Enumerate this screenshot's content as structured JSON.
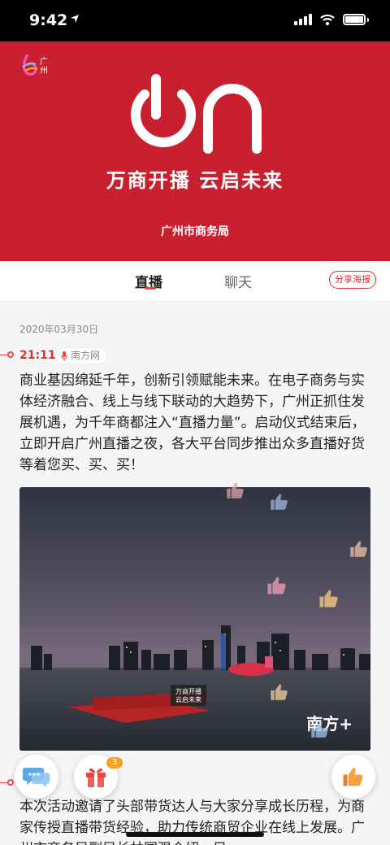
{
  "status_bar": {
    "time": "9:42",
    "location_arrow": "location-arrow-icon"
  },
  "banner": {
    "logo_text": "广州",
    "slogan": "万商开播  云启未来",
    "bureau": "广州市商务局",
    "bg_color": "#c9202f"
  },
  "tabs": [
    {
      "label": "直播",
      "active": true
    },
    {
      "label": "聊天",
      "active": false
    }
  ],
  "share_poster": "分享海报",
  "feed": {
    "date": "2020年03月30日",
    "post": {
      "time": "21:11",
      "source": "南方网",
      "text": "商业基因绵延千年，创新引领赋能未来。在电子商务与实体经济融合、线上与线下联动的大趋势下，广州正抓住发展机遇，为千年商都注入“直播力量”。启动仪式结束后，立即开启广州直播之夜，各大平台同步推出众多直播好货等着您买、买、买！",
      "photo": {
        "stage_text": "万商开播 云启未来",
        "watermark": "南方+"
      }
    },
    "post2_text": "本次活动邀请了头部带货达人与大家分享成长历程，为商家传授直播带货经验，助力传统商贸企业在线上发展。广州市商务局副局长林国强介绍，目"
  },
  "fabs": {
    "gift_count": "3"
  },
  "accent": "#e8452a"
}
